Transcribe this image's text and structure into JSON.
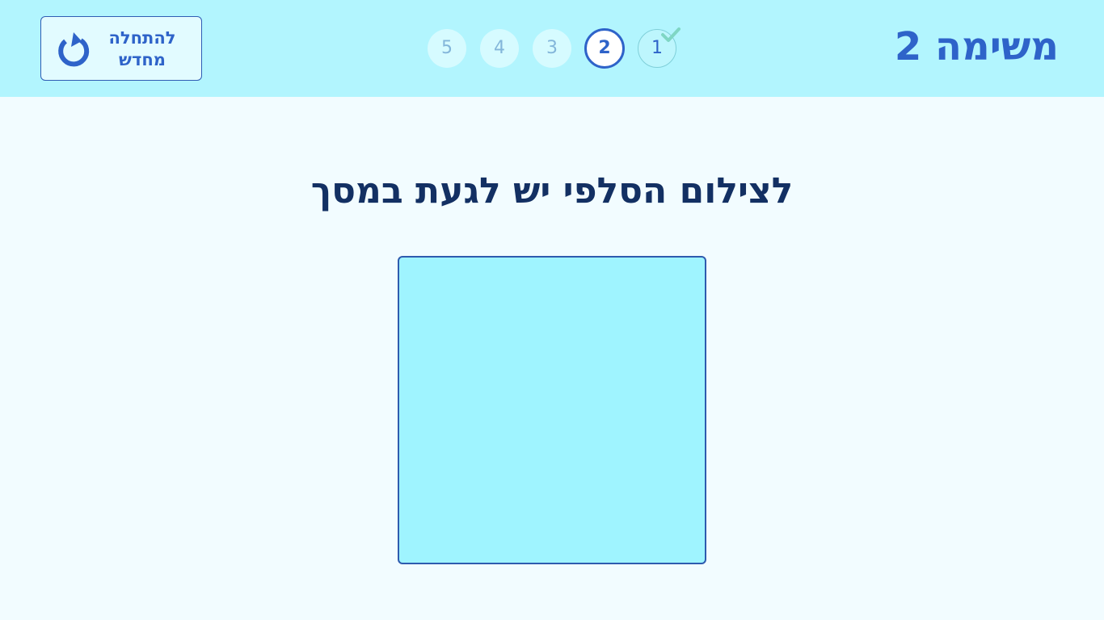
{
  "header": {
    "title": "משימה 2",
    "restart": {
      "label_line1": "להתחלה",
      "label_line2": "מחדש",
      "icon": "restart-icon"
    }
  },
  "stepper": {
    "steps": [
      {
        "number": "1",
        "status": "done",
        "icon": "check-icon"
      },
      {
        "number": "2",
        "status": "current"
      },
      {
        "number": "3",
        "status": "todo"
      },
      {
        "number": "4",
        "status": "todo"
      },
      {
        "number": "5",
        "status": "todo"
      }
    ]
  },
  "main": {
    "instruction": "לצילום הסלפי יש לגעת במסך"
  },
  "colors": {
    "header_bg": "#b2f5fe",
    "page_bg": "#f2fcff",
    "accent": "#2e63c9",
    "heading": "#133063",
    "camera_bg": "#9ff4ff",
    "check": "#7fd6c4"
  }
}
